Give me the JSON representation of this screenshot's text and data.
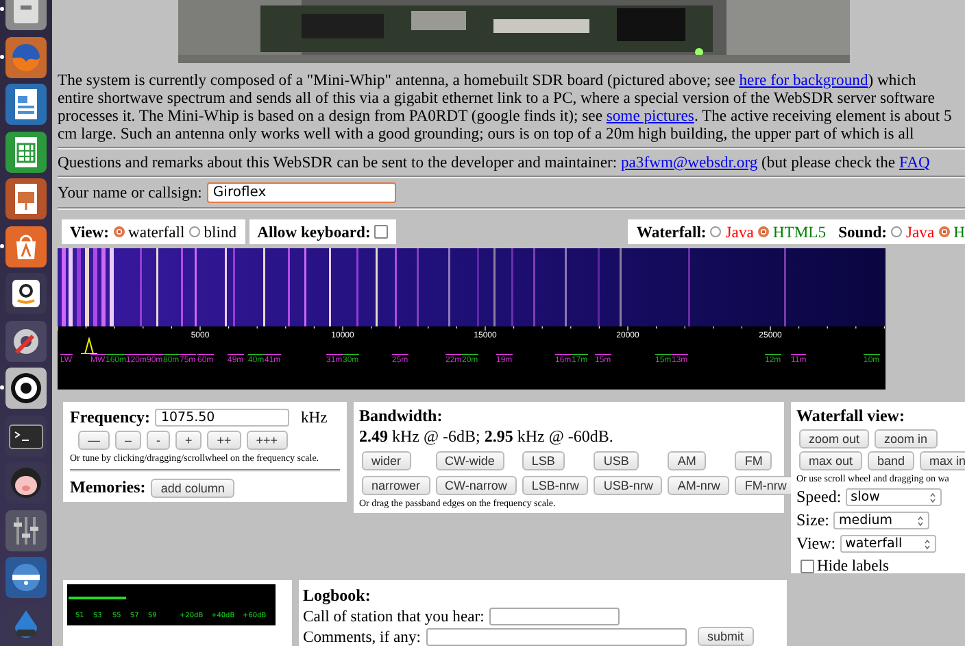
{
  "launcher": [
    {
      "kind": "files",
      "running": true
    },
    {
      "kind": "browser",
      "running": true
    },
    {
      "kind": "writer",
      "running": false
    },
    {
      "kind": "calc",
      "running": false
    },
    {
      "kind": "impress",
      "running": false
    },
    {
      "kind": "store",
      "running": true
    },
    {
      "kind": "shop",
      "running": false
    },
    {
      "kind": "settings",
      "running": false
    },
    {
      "kind": "ring",
      "running": true
    },
    {
      "kind": "terminal",
      "running": false
    },
    {
      "kind": "pig",
      "running": false
    },
    {
      "kind": "mixer",
      "running": false
    },
    {
      "kind": "disc",
      "running": false
    },
    {
      "kind": "drop",
      "running": false
    }
  ],
  "intro": [
    {
      "text": "The system is currently composed of a \"Mini-Whip\" antenna, a homebuilt SDR board (pictured above; see "
    },
    {
      "link": "here for background"
    },
    {
      "text": ") which\nentire shortwave spectrum and sends all of this via a gigabit ethernet link to a PC, where a special version of the WebSDR server software\nprocesses it. The Mini-Whip is based on a design from PA0RDT (google finds it); see "
    },
    {
      "link": "some pictures"
    },
    {
      "text": ". The active receiving element is about 5\ncm large. Such an antenna only works well with a good grounding; ours is on top of a 20m high building, the upper part of which is all"
    }
  ],
  "contact": [
    {
      "text": "Questions and remarks about this WebSDR can be sent to the developer and maintainer: "
    },
    {
      "link": "pa3fwm@websdr.org"
    },
    {
      "text": " (but please check the "
    },
    {
      "link": "FAQ"
    }
  ],
  "name_field": {
    "label": "Your name or callsign:",
    "value": "Giroflex"
  },
  "view": {
    "label": "View:",
    "options": [
      {
        "label": "waterfall",
        "selected": true
      },
      {
        "label": "blind",
        "selected": false
      }
    ]
  },
  "keyboard": {
    "label": "Allow keyboard:",
    "checked": false
  },
  "waterfall_engine": {
    "label": "Waterfall:",
    "options": [
      {
        "label": "Java",
        "selected": false,
        "color": "#ff0000"
      },
      {
        "label": "HTML5",
        "selected": true,
        "color": "#008000"
      }
    ]
  },
  "sound": {
    "label": "Sound:",
    "options": [
      {
        "label": "Java",
        "selected": false,
        "color": "#ff0000"
      },
      {
        "label": "H",
        "selected": true,
        "color": "#008000"
      }
    ]
  },
  "scale": {
    "ticks": [
      "5000",
      "10000",
      "15000",
      "20000",
      "25000"
    ],
    "bands": [
      {
        "label": "LW",
        "color": "#cc33cc"
      },
      {
        "label": "MW",
        "color": "#cc33cc"
      },
      {
        "label": "160m",
        "color": "#22aa22"
      },
      {
        "label": "120m",
        "color": "#cc33cc"
      },
      {
        "label": "90m",
        "color": "#cc33cc"
      },
      {
        "label": "80m",
        "color": "#22aa22"
      },
      {
        "label": "75m",
        "color": "#cc33cc"
      },
      {
        "label": "60m",
        "color": "#cc33cc"
      },
      {
        "label": "49m",
        "color": "#cc33cc"
      },
      {
        "label": "40m",
        "color": "#22aa22"
      },
      {
        "label": "41m",
        "color": "#cc33cc"
      },
      {
        "label": "31m",
        "color": "#cc33cc"
      },
      {
        "label": "30m",
        "color": "#22aa22"
      },
      {
        "label": "25m",
        "color": "#cc33cc"
      },
      {
        "label": "22m",
        "color": "#cc33cc"
      },
      {
        "label": "20m",
        "color": "#22aa22"
      },
      {
        "label": "19m",
        "color": "#cc33cc"
      },
      {
        "label": "16m",
        "color": "#cc33cc"
      },
      {
        "label": "17m",
        "color": "#22aa22"
      },
      {
        "label": "15m",
        "color": "#cc33cc"
      },
      {
        "label": "15m",
        "color": "#22aa22"
      },
      {
        "label": "13m",
        "color": "#cc33cc"
      },
      {
        "label": "12m",
        "color": "#22aa22"
      },
      {
        "label": "11m",
        "color": "#cc33cc"
      },
      {
        "label": "10m",
        "color": "#22aa22"
      }
    ]
  },
  "frequency": {
    "label": "Frequency:",
    "value": "1075.50",
    "unit": "kHz",
    "buttons": [
      "—",
      "–",
      "-",
      "+",
      "++",
      "+++"
    ],
    "hint": "Or tune by clicking/dragging/scrollwheel on the frequency scale."
  },
  "memories": {
    "label": "Memories:",
    "button": "add column"
  },
  "bandwidth": {
    "title": "Bandwidth:",
    "reading": "**2.49** kHz @ -6dB; **2.95** kHz @ -60dB.",
    "rows": [
      [
        "wider",
        "CW-wide",
        "LSB",
        "USB",
        "AM",
        "FM"
      ],
      [
        "narrower",
        "CW-narrow",
        "LSB-nrw",
        "USB-nrw",
        "AM-nrw",
        "FM-nrw"
      ]
    ],
    "hint": "Or drag the passband edges on the frequency scale."
  },
  "waterfall_view": {
    "title": "Waterfall view:",
    "rows": [
      [
        "zoom out",
        "zoom in"
      ],
      [
        "max out",
        "band",
        "max in"
      ]
    ],
    "hint": "Or use scroll wheel and dragging on wa",
    "selects": [
      {
        "label": "Speed:",
        "value": "slow"
      },
      {
        "label": "Size:",
        "value": "medium"
      },
      {
        "label": "View:",
        "value": "waterfall"
      }
    ],
    "hide_labels": {
      "label": "Hide labels",
      "checked": false
    }
  },
  "smeter": {
    "level": 0.28,
    "ticks": [
      "S1",
      "S3",
      "S5",
      "S7",
      "S9",
      "+20dB",
      "+40dB",
      "+60dB"
    ]
  },
  "logbook": {
    "title": "Logbook:",
    "fields": [
      {
        "label": "Call of station that you hear:"
      },
      {
        "label": "Comments, if any:"
      }
    ],
    "submit": "submit"
  }
}
